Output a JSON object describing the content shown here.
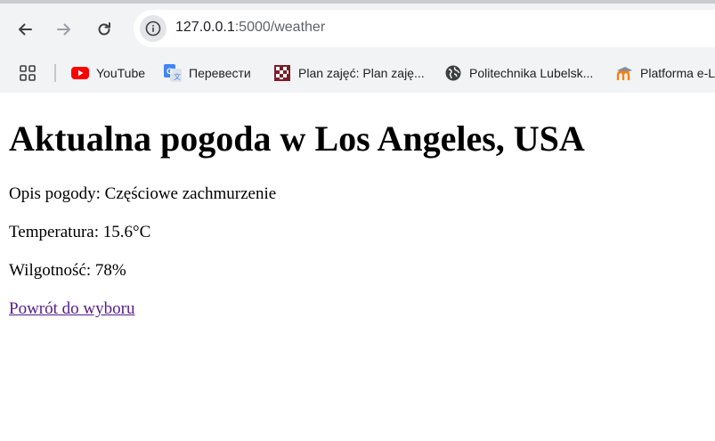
{
  "browser": {
    "url_host": "127.0.0.1",
    "url_rest": ":5000/weather",
    "bookmarks": [
      {
        "label": "YouTube",
        "icon": "youtube-icon"
      },
      {
        "label": "Перевести",
        "icon": "google-translate-icon"
      },
      {
        "label": "Plan zajęć: Plan zaję...",
        "icon": "plan-zajec-icon"
      },
      {
        "label": "Politechnika Lubelsk...",
        "icon": "globe-icon"
      },
      {
        "label": "Platforma e-L",
        "icon": "moodle-icon"
      }
    ],
    "colors": {
      "youtube_red": "#ff0000",
      "link_visited": "#551a8b",
      "chrome_bg": "#f1f3f4"
    }
  },
  "page": {
    "title": "Aktualna pogoda w Los Angeles, USA",
    "description": "Opis pogody: Częściowe zachmurzenie",
    "temperature": "Temperatura: 15.6°C",
    "humidity": "Wilgotność: 78%",
    "back_link": "Powrót do wyboru"
  }
}
